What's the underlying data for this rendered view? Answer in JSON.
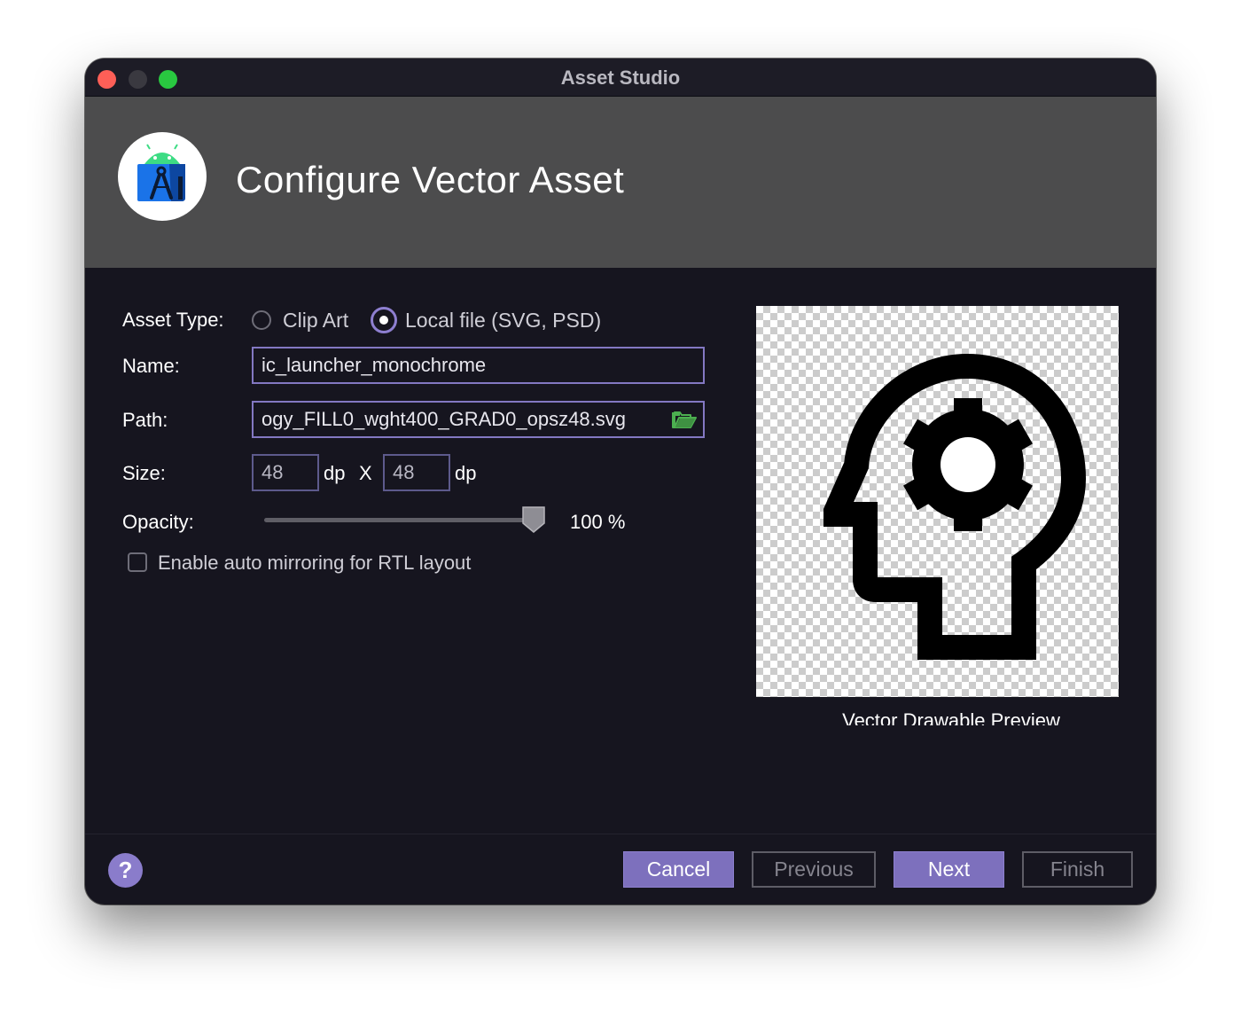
{
  "window": {
    "title": "Asset Studio"
  },
  "header": {
    "title": "Configure Vector Asset",
    "logo_icon": "android-studio-logo-icon"
  },
  "form": {
    "asset_type_label": "Asset Type:",
    "asset_type_options": [
      {
        "label": "Clip Art",
        "selected": false
      },
      {
        "label": "Local file (SVG, PSD)",
        "selected": true
      }
    ],
    "name_label": "Name:",
    "name_value": "ic_launcher_monochrome",
    "path_label": "Path:",
    "path_value": "ogy_FILL0_wght400_GRAD0_opsz48.svg",
    "path_icon": "folder-open-icon",
    "size_label": "Size:",
    "width_value": "48",
    "height_value": "48",
    "unit_label": "dp",
    "times_label": "X",
    "opacity_label": "Opacity:",
    "opacity_value": 1.0,
    "opacity_text": "100 %",
    "auto_mirror_label": "Enable auto mirroring for RTL layout",
    "auto_mirror_checked": false
  },
  "preview": {
    "caption": "Vector Drawable Preview",
    "icon": "head-gear-psychology-icon"
  },
  "footer": {
    "help_label": "?",
    "cancel_label": "Cancel",
    "previous_label": "Previous",
    "next_label": "Next",
    "finish_label": "Finish"
  },
  "colors": {
    "accent": "#7d70bd",
    "background": "#16151f",
    "header": "#4c4c4d"
  }
}
